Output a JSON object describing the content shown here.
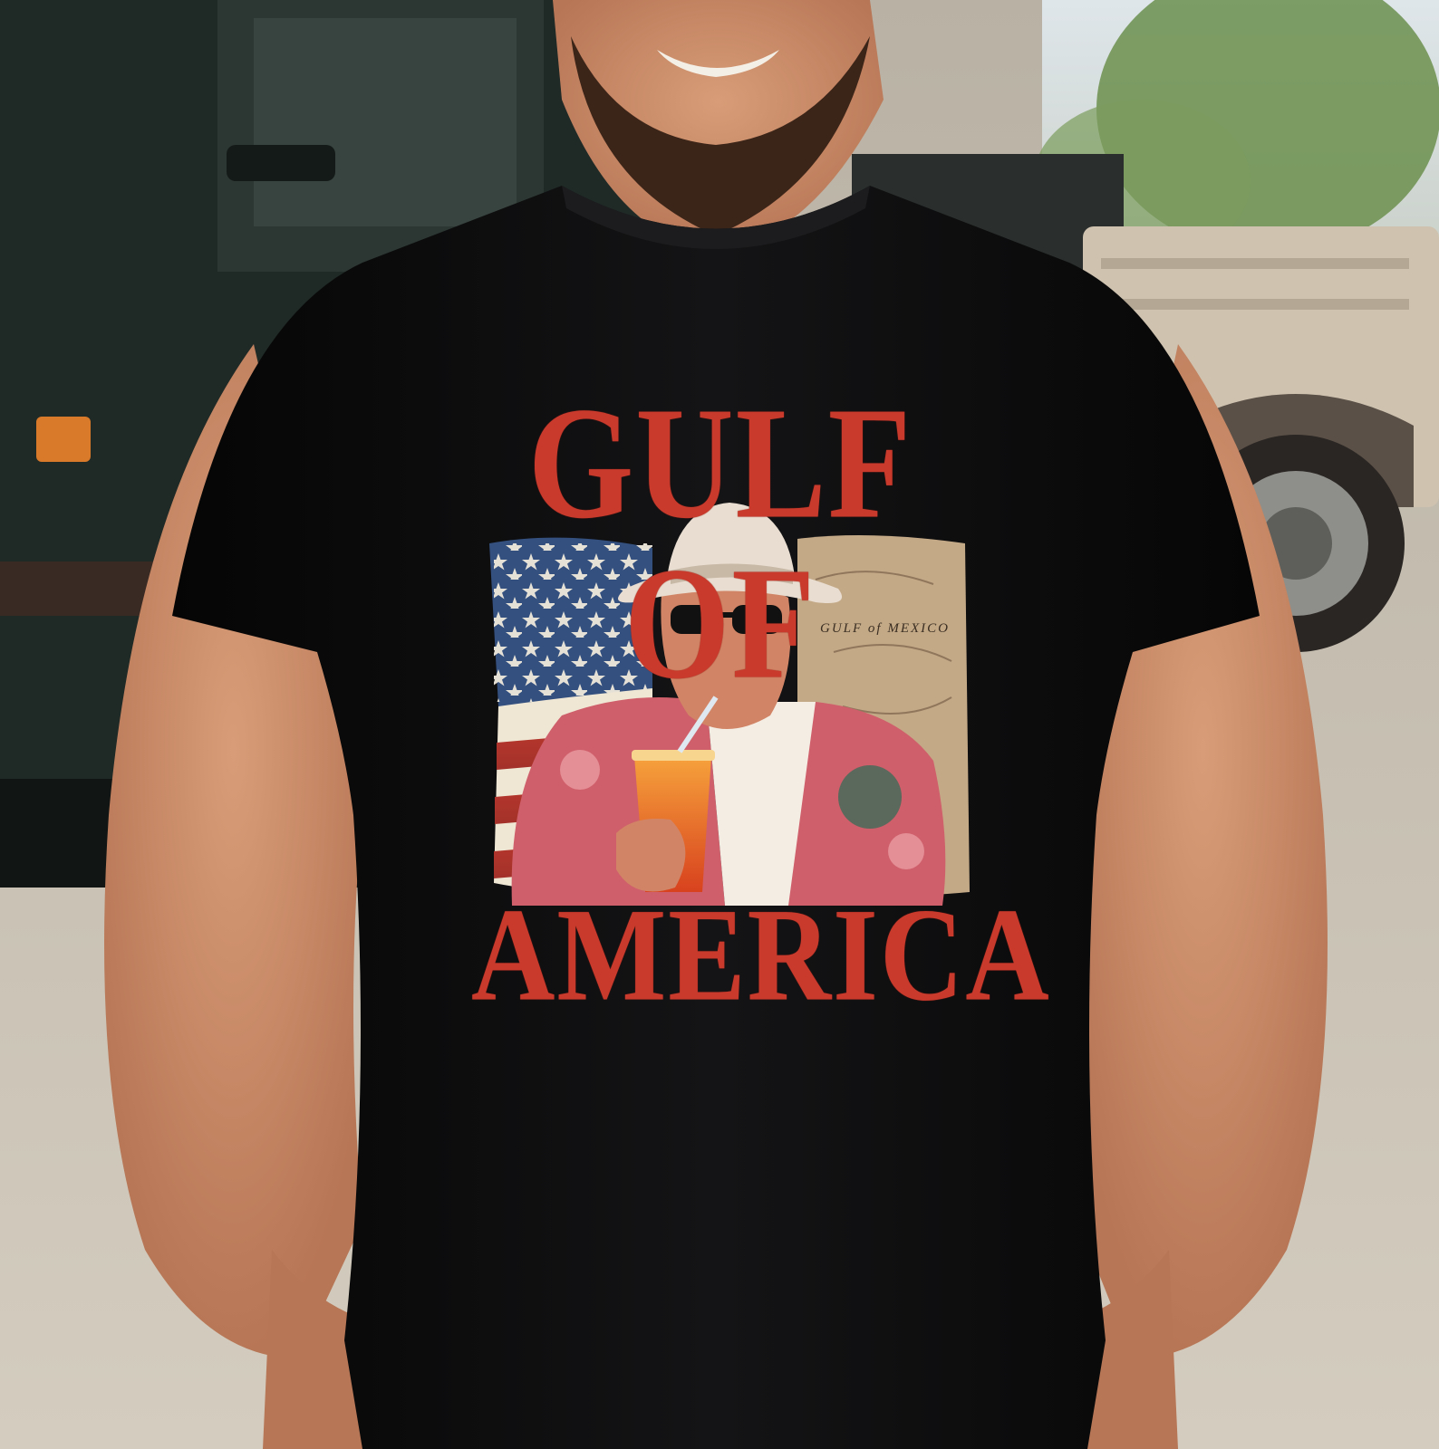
{
  "image": {
    "kind": "product photo",
    "print": {
      "headline_top": "GULF OF",
      "headline_bottom": "AMERICA",
      "map_label": "GULF of MEXICO"
    },
    "colors": {
      "shirt": "#0d0d0e",
      "print_red": "#c93a2c",
      "flag_blue": "#34507f",
      "map_tan": "#c4a987",
      "jacket_pink": "#cf5f6a",
      "drink_orange": "#f07a24",
      "hat_cream": "#e8ddd0",
      "skin": "#c98a66",
      "beard": "#3b2418",
      "truck": "#1f2926",
      "foliage": "#6b8f4e"
    }
  }
}
